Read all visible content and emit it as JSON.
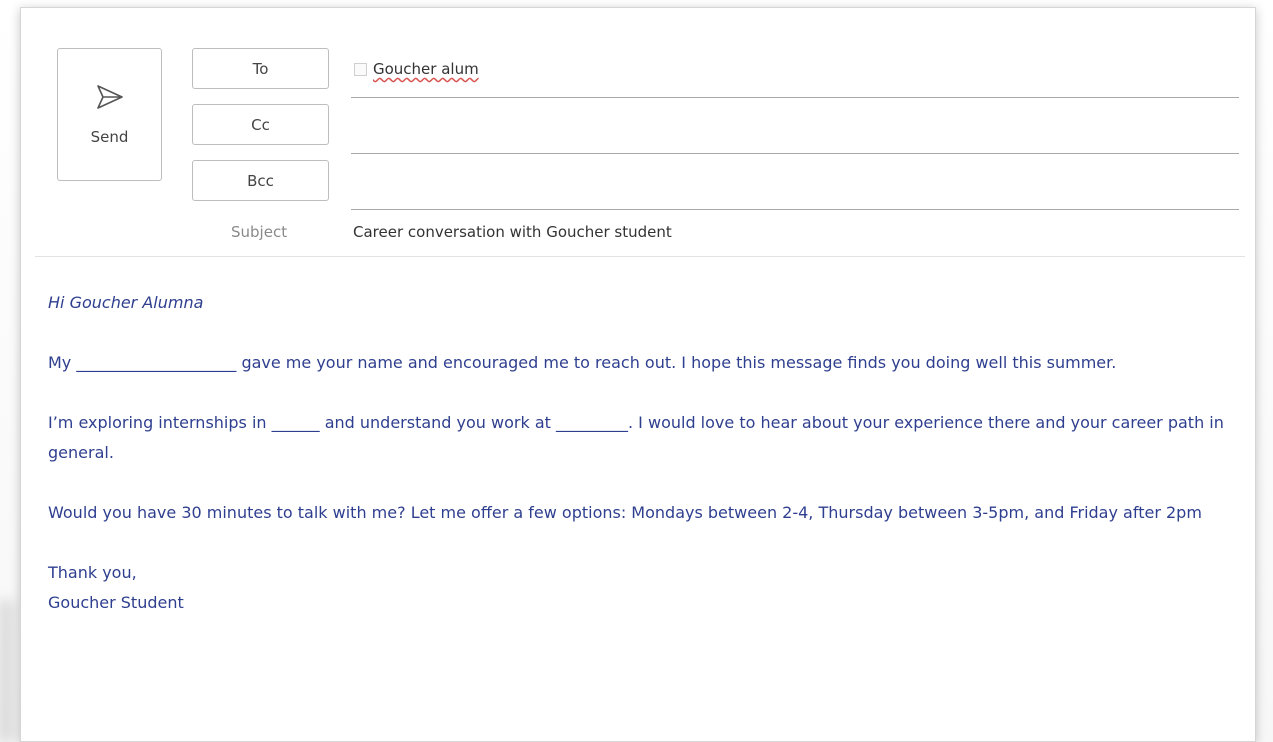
{
  "toolbar": {
    "send_label": "Send",
    "send_icon": "send-icon"
  },
  "recipients": {
    "to_label": "To",
    "cc_label": "Cc",
    "bcc_label": "Bcc",
    "to_value": "Goucher alum",
    "cc_value": "",
    "bcc_value": ""
  },
  "subject": {
    "label": "Subject",
    "value": "Career conversation with Goucher student"
  },
  "body": {
    "greeting": "Hi Goucher Alumna",
    "paragraph_1": "My ____________________ gave me your name and encouraged me to reach out.  I hope this message finds you doing well this summer.",
    "paragraph_2": "I’m exploring internships in ______ and understand you work at _________.   I would love to hear about your experience there and your career path in general.",
    "paragraph_3": "Would you have 30 minutes to talk with me?  Let me offer a few options:  Mondays between 2-4, Thursday between 3-5pm, and Friday after 2pm",
    "closing": "Thank you,",
    "signature": "Goucher Student"
  },
  "colors": {
    "body_text": "#2f3f8f",
    "spellcheck_underline": "#d9534f"
  }
}
